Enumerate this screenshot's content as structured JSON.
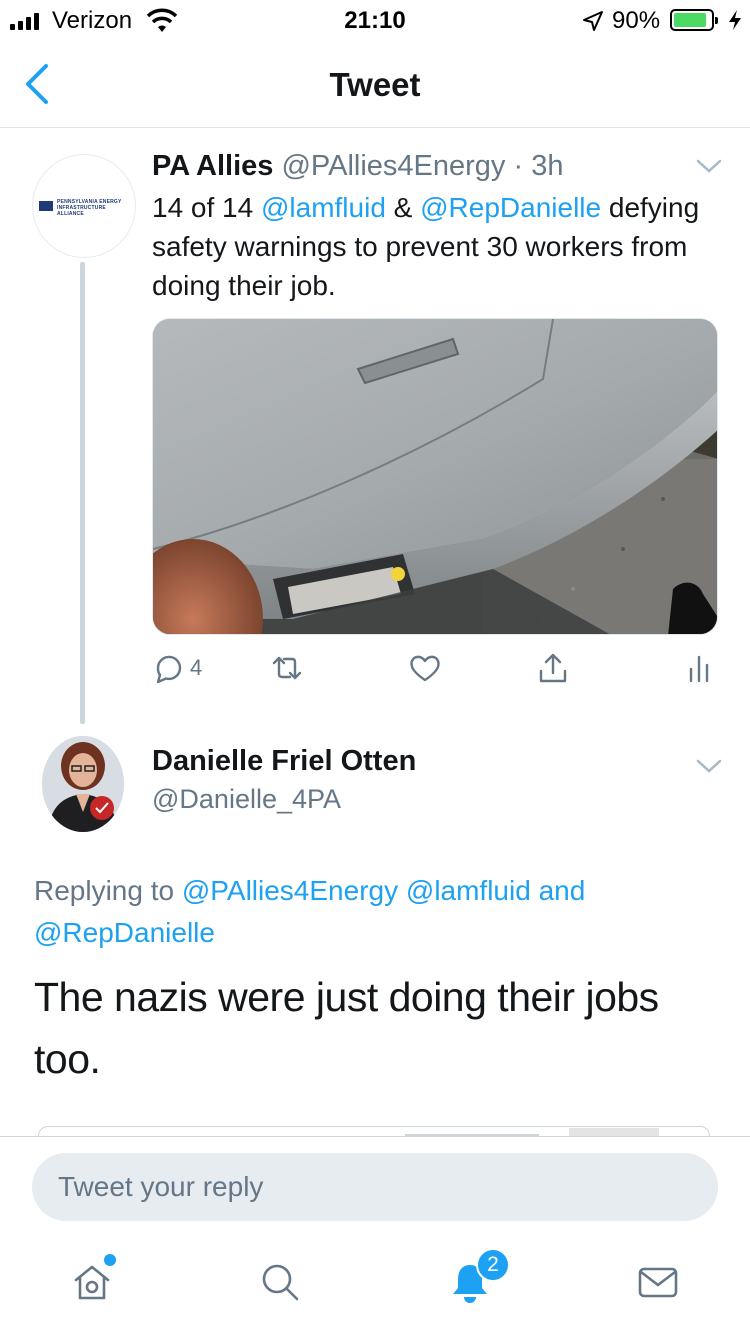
{
  "status_bar": {
    "carrier": "Verizon",
    "time": "21:10",
    "battery_percent": "90%",
    "battery_level": 0.9,
    "icons": [
      "signal-icon",
      "wifi-icon",
      "location-icon",
      "battery-icon",
      "charging-bolt-icon"
    ]
  },
  "nav": {
    "title": "Tweet",
    "back_icon": "chevron-left-icon"
  },
  "tweet1": {
    "avatar_logo_text": "PENNSYLVANIA ENERGY INFRASTRUCTURE ALLIANCE",
    "name": "PA Allies",
    "handle": "@PAllies4Energy",
    "time": "· 3h",
    "text_prefix": "14 of 14 ",
    "mention1": "@lamfluid",
    "text_amp": " & ",
    "mention2": "@RepDanielle",
    "text_body": " defying safety warnings to prevent 30 workers from doing their job.",
    "replies_count": "4"
  },
  "tweet2": {
    "name": "Danielle Friel Otten",
    "handle": "@Danielle_4PA",
    "replying_prefix": "Replying to ",
    "reply_mention1": "@PAllies4Energy",
    "reply_mention2": "@lamfluid",
    "reply_and": " and ",
    "reply_mention3": "@RepDanielle",
    "text": "The nazis were just doing their jobs too."
  },
  "reply_bar": {
    "placeholder": "Tweet your reply"
  },
  "tab_bar": {
    "items": [
      "home-icon",
      "search-icon",
      "notifications-icon",
      "messages-icon"
    ],
    "notifications_badge": "2"
  },
  "colors": {
    "accent": "#1da1f2",
    "secondary_text": "#657786",
    "divider": "#e1e8ed"
  }
}
